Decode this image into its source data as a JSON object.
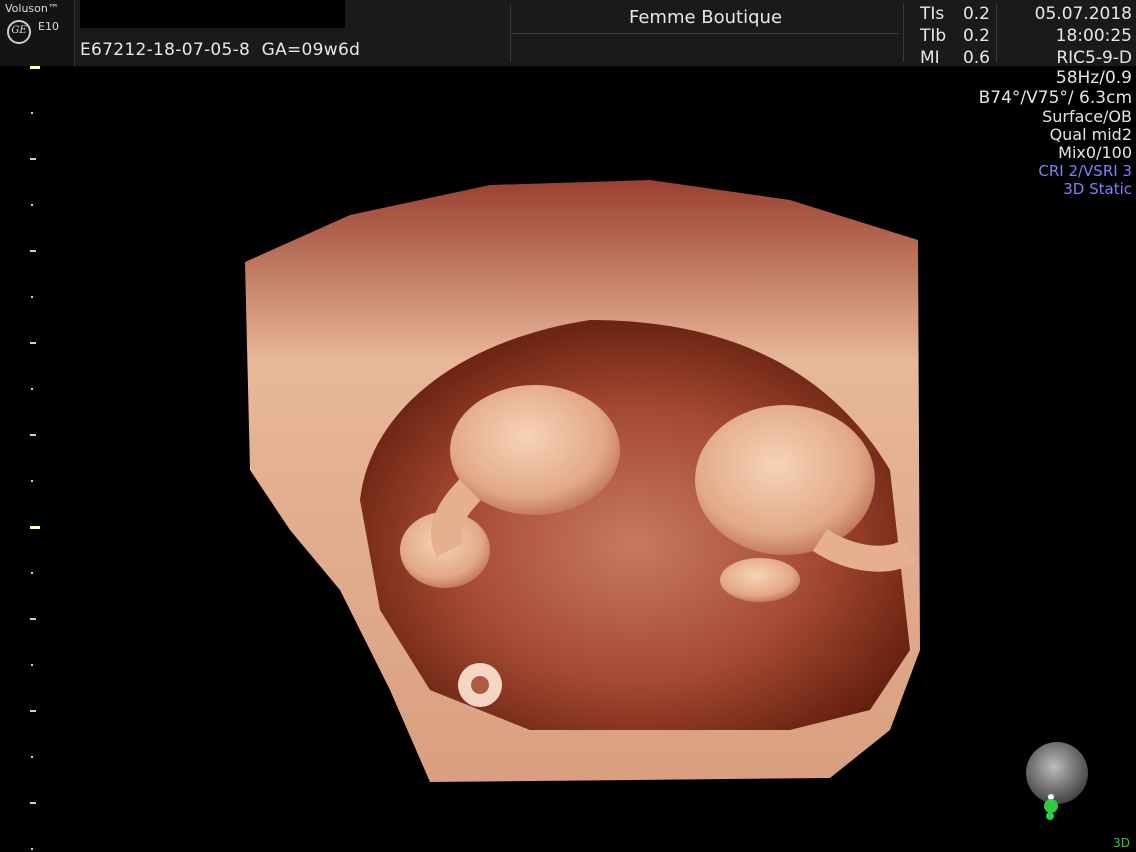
{
  "header": {
    "brand": "Voluson™",
    "model": "E10",
    "logo": "GE",
    "patient_id": "E67212-18-07-05-8",
    "gestational_age": "GA=09w6d",
    "clinic_name": "Femme Boutique",
    "indices": [
      {
        "label": "TIs",
        "value": "0.2"
      },
      {
        "label": "TIb",
        "value": "0.2"
      },
      {
        "label": "MI",
        "value": "0.6"
      }
    ],
    "date": "05.07.2018",
    "time": "18:00:25",
    "probe": "RIC5-9-D"
  },
  "parameters": {
    "frame_rate": "58Hz/0.9",
    "angles_depth": "B74°/V75°/ 6.3cm",
    "preset": "Surface/OB",
    "quality": "Qual mid2",
    "mix": "Mix0/100",
    "cri": "CRI 2/VSRI 3",
    "mode": "3D Static"
  },
  "footer": {
    "mode_badge": "3D"
  },
  "colors": {
    "tissue_light": "#f0c4a4",
    "tissue_mid": "#c9856a",
    "tissue_dark": "#7a2a18",
    "highlight_blue": "#8080ff",
    "marker_green": "#2ecc40"
  }
}
